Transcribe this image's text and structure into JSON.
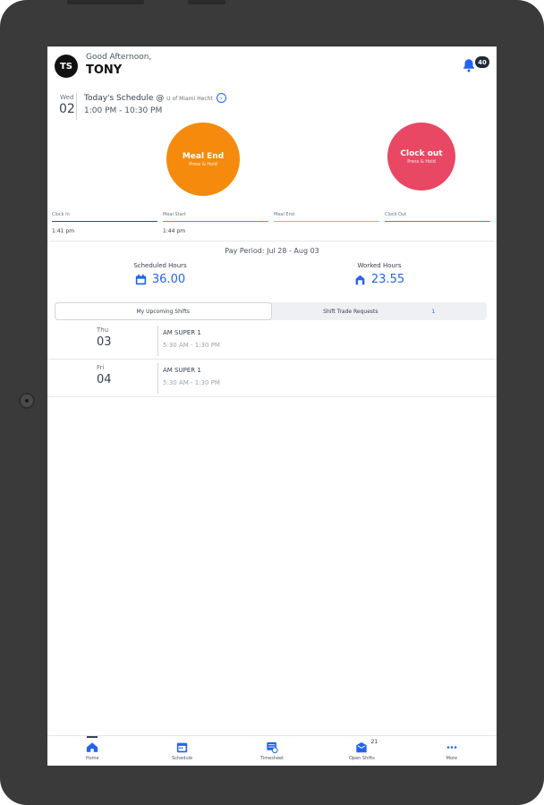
{
  "header": {
    "avatar_initials": "TS",
    "greeting": "Good Afternoon,",
    "user_name": "TONY",
    "notification_count": "40"
  },
  "schedule": {
    "day_of_week": "Wed",
    "day": "02",
    "title": "Today's Schedule @",
    "location": "U of Miami Hecht",
    "time_range": "1:00 PM - 10:30 PM"
  },
  "actions": {
    "meal_end_label": "Meal End",
    "meal_end_hint": "Press & Hold",
    "clock_out_label": "Clock out",
    "clock_out_hint": "Press & Hold"
  },
  "punches": [
    {
      "label": "Clock In",
      "value": "1:41 pm"
    },
    {
      "label": "Meal Start",
      "value": "1:44 pm"
    },
    {
      "label": "Meal End",
      "value": ""
    },
    {
      "label": "Clock Out",
      "value": ""
    }
  ],
  "pay_period": "Pay Period: Jul 28 - Aug 03",
  "hours": {
    "scheduled_label": "Scheduled Hours",
    "scheduled_value": "36.00",
    "worked_label": "Worked Hours",
    "worked_value": "23.55"
  },
  "tabs": [
    {
      "label": "My Upcoming Shifts",
      "count": ""
    },
    {
      "label": "Shift Trade Requests",
      "count": "1"
    }
  ],
  "shifts": [
    {
      "dow": "Thu",
      "day": "03",
      "title": "AM SUPER 1",
      "time": "5:30 AM - 1:30 PM"
    },
    {
      "dow": "Fri",
      "day": "04",
      "title": "AM SUPER 1",
      "time": "5:30 AM - 1:30 PM"
    }
  ],
  "nav": {
    "home": "Home",
    "schedule": "Schedule",
    "timesheet": "Timesheet",
    "open_shifts": "Open Shifts",
    "open_shifts_count": "21",
    "more": "More"
  },
  "colors": {
    "accent": "#2563eb",
    "meal_button": "#f58a0c",
    "clock_out_button": "#e84863"
  }
}
